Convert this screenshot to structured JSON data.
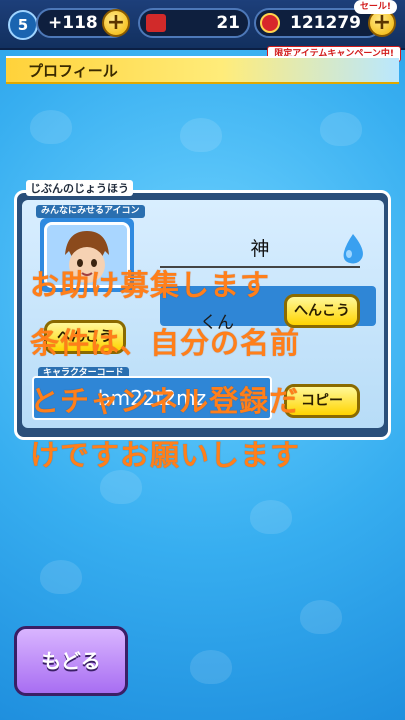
{
  "topbar": {
    "level": "5",
    "currency_a": "+118",
    "plus_a": "+",
    "count_b": "21",
    "currency_c": "121279",
    "plus_c": "+",
    "sale_tag": "セール!",
    "campaign": "限定アイテムキャンペーン中!"
  },
  "page_title": "プロフィール",
  "section_label": "じぶんのじょうほう",
  "icon_label": "みんなにみせるアイコン",
  "icon_button": "へんこう",
  "name_value": "神",
  "honor_value": "くん",
  "honor_button": "へんこう",
  "code_label": "キャラクターコード",
  "code_value": "bm22t2mz",
  "code_button": "コピー",
  "overlay_lines": [
    "お助け募集します",
    "条件は、自分の名前",
    "とチャンネル登録だ",
    "けですお願いします"
  ],
  "back_button": "もどる"
}
